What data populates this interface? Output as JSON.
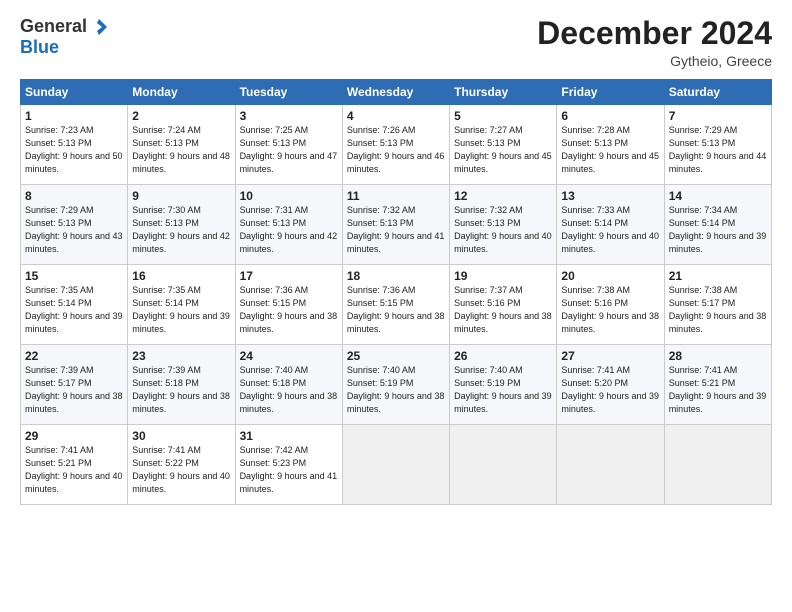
{
  "header": {
    "logo_general": "General",
    "logo_blue": "Blue",
    "month_title": "December 2024",
    "location": "Gytheio, Greece"
  },
  "weekdays": [
    "Sunday",
    "Monday",
    "Tuesday",
    "Wednesday",
    "Thursday",
    "Friday",
    "Saturday"
  ],
  "weeks": [
    [
      {
        "day": "1",
        "sunrise": "Sunrise: 7:23 AM",
        "sunset": "Sunset: 5:13 PM",
        "daylight": "Daylight: 9 hours and 50 minutes."
      },
      {
        "day": "2",
        "sunrise": "Sunrise: 7:24 AM",
        "sunset": "Sunset: 5:13 PM",
        "daylight": "Daylight: 9 hours and 48 minutes."
      },
      {
        "day": "3",
        "sunrise": "Sunrise: 7:25 AM",
        "sunset": "Sunset: 5:13 PM",
        "daylight": "Daylight: 9 hours and 47 minutes."
      },
      {
        "day": "4",
        "sunrise": "Sunrise: 7:26 AM",
        "sunset": "Sunset: 5:13 PM",
        "daylight": "Daylight: 9 hours and 46 minutes."
      },
      {
        "day": "5",
        "sunrise": "Sunrise: 7:27 AM",
        "sunset": "Sunset: 5:13 PM",
        "daylight": "Daylight: 9 hours and 45 minutes."
      },
      {
        "day": "6",
        "sunrise": "Sunrise: 7:28 AM",
        "sunset": "Sunset: 5:13 PM",
        "daylight": "Daylight: 9 hours and 45 minutes."
      },
      {
        "day": "7",
        "sunrise": "Sunrise: 7:29 AM",
        "sunset": "Sunset: 5:13 PM",
        "daylight": "Daylight: 9 hours and 44 minutes."
      }
    ],
    [
      {
        "day": "8",
        "sunrise": "Sunrise: 7:29 AM",
        "sunset": "Sunset: 5:13 PM",
        "daylight": "Daylight: 9 hours and 43 minutes."
      },
      {
        "day": "9",
        "sunrise": "Sunrise: 7:30 AM",
        "sunset": "Sunset: 5:13 PM",
        "daylight": "Daylight: 9 hours and 42 minutes."
      },
      {
        "day": "10",
        "sunrise": "Sunrise: 7:31 AM",
        "sunset": "Sunset: 5:13 PM",
        "daylight": "Daylight: 9 hours and 42 minutes."
      },
      {
        "day": "11",
        "sunrise": "Sunrise: 7:32 AM",
        "sunset": "Sunset: 5:13 PM",
        "daylight": "Daylight: 9 hours and 41 minutes."
      },
      {
        "day": "12",
        "sunrise": "Sunrise: 7:32 AM",
        "sunset": "Sunset: 5:13 PM",
        "daylight": "Daylight: 9 hours and 40 minutes."
      },
      {
        "day": "13",
        "sunrise": "Sunrise: 7:33 AM",
        "sunset": "Sunset: 5:14 PM",
        "daylight": "Daylight: 9 hours and 40 minutes."
      },
      {
        "day": "14",
        "sunrise": "Sunrise: 7:34 AM",
        "sunset": "Sunset: 5:14 PM",
        "daylight": "Daylight: 9 hours and 39 minutes."
      }
    ],
    [
      {
        "day": "15",
        "sunrise": "Sunrise: 7:35 AM",
        "sunset": "Sunset: 5:14 PM",
        "daylight": "Daylight: 9 hours and 39 minutes."
      },
      {
        "day": "16",
        "sunrise": "Sunrise: 7:35 AM",
        "sunset": "Sunset: 5:14 PM",
        "daylight": "Daylight: 9 hours and 39 minutes."
      },
      {
        "day": "17",
        "sunrise": "Sunrise: 7:36 AM",
        "sunset": "Sunset: 5:15 PM",
        "daylight": "Daylight: 9 hours and 38 minutes."
      },
      {
        "day": "18",
        "sunrise": "Sunrise: 7:36 AM",
        "sunset": "Sunset: 5:15 PM",
        "daylight": "Daylight: 9 hours and 38 minutes."
      },
      {
        "day": "19",
        "sunrise": "Sunrise: 7:37 AM",
        "sunset": "Sunset: 5:16 PM",
        "daylight": "Daylight: 9 hours and 38 minutes."
      },
      {
        "day": "20",
        "sunrise": "Sunrise: 7:38 AM",
        "sunset": "Sunset: 5:16 PM",
        "daylight": "Daylight: 9 hours and 38 minutes."
      },
      {
        "day": "21",
        "sunrise": "Sunrise: 7:38 AM",
        "sunset": "Sunset: 5:17 PM",
        "daylight": "Daylight: 9 hours and 38 minutes."
      }
    ],
    [
      {
        "day": "22",
        "sunrise": "Sunrise: 7:39 AM",
        "sunset": "Sunset: 5:17 PM",
        "daylight": "Daylight: 9 hours and 38 minutes."
      },
      {
        "day": "23",
        "sunrise": "Sunrise: 7:39 AM",
        "sunset": "Sunset: 5:18 PM",
        "daylight": "Daylight: 9 hours and 38 minutes."
      },
      {
        "day": "24",
        "sunrise": "Sunrise: 7:40 AM",
        "sunset": "Sunset: 5:18 PM",
        "daylight": "Daylight: 9 hours and 38 minutes."
      },
      {
        "day": "25",
        "sunrise": "Sunrise: 7:40 AM",
        "sunset": "Sunset: 5:19 PM",
        "daylight": "Daylight: 9 hours and 38 minutes."
      },
      {
        "day": "26",
        "sunrise": "Sunrise: 7:40 AM",
        "sunset": "Sunset: 5:19 PM",
        "daylight": "Daylight: 9 hours and 39 minutes."
      },
      {
        "day": "27",
        "sunrise": "Sunrise: 7:41 AM",
        "sunset": "Sunset: 5:20 PM",
        "daylight": "Daylight: 9 hours and 39 minutes."
      },
      {
        "day": "28",
        "sunrise": "Sunrise: 7:41 AM",
        "sunset": "Sunset: 5:21 PM",
        "daylight": "Daylight: 9 hours and 39 minutes."
      }
    ],
    [
      {
        "day": "29",
        "sunrise": "Sunrise: 7:41 AM",
        "sunset": "Sunset: 5:21 PM",
        "daylight": "Daylight: 9 hours and 40 minutes."
      },
      {
        "day": "30",
        "sunrise": "Sunrise: 7:41 AM",
        "sunset": "Sunset: 5:22 PM",
        "daylight": "Daylight: 9 hours and 40 minutes."
      },
      {
        "day": "31",
        "sunrise": "Sunrise: 7:42 AM",
        "sunset": "Sunset: 5:23 PM",
        "daylight": "Daylight: 9 hours and 41 minutes."
      },
      null,
      null,
      null,
      null
    ]
  ]
}
